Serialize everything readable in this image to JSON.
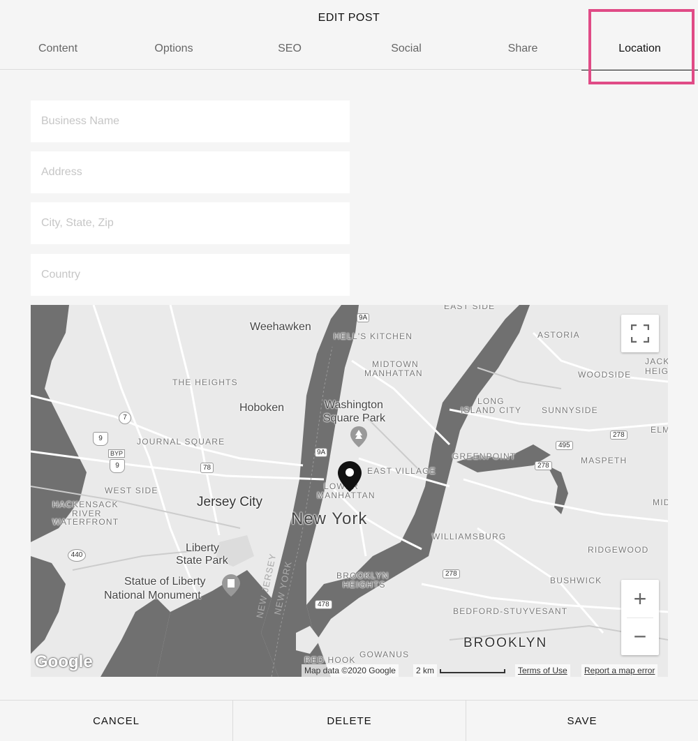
{
  "dialog": {
    "title": "EDIT POST"
  },
  "tabs": [
    {
      "label": "Content"
    },
    {
      "label": "Options"
    },
    {
      "label": "SEO"
    },
    {
      "label": "Social"
    },
    {
      "label": "Share"
    },
    {
      "label": "Location",
      "active": true
    }
  ],
  "highlight_color": "#e04b86",
  "form": {
    "business_name": {
      "value": "",
      "placeholder": "Business Name"
    },
    "address": {
      "value": "",
      "placeholder": "Address"
    },
    "city_state_zip": {
      "value": "",
      "placeholder": "City, State, Zip"
    },
    "country": {
      "value": "",
      "placeholder": "Country"
    }
  },
  "map": {
    "labels": {
      "east_side": "EAST SIDE",
      "weehawken": "Weehawken",
      "hells_kitchen": "HELL'S KITCHEN",
      "astoria": "ASTORIA",
      "jackson_heights": "JACK HEIG",
      "midtown": "MIDTOWN",
      "manhattan": "MANHATTAN",
      "the_heights": "THE HEIGHTS",
      "woodside": "WOODSIDE",
      "hoboken": "Hoboken",
      "washington_sq": "Washington",
      "square_park": "Square Park",
      "long_island_city_1": "LONG",
      "long_island_city_2": "ISLAND CITY",
      "sunnyside": "SUNNYSIDE",
      "journal_square": "JOURNAL SQUARE",
      "elm": "ELM",
      "greenpoint": "GREENPOINT",
      "maspeth": "MASPETH",
      "east_village": "EAST VILLAGE",
      "west_side": "WEST SIDE",
      "lower_manhattan_1": "LOWER",
      "lower_manhattan_2": "MANHATTAN",
      "jersey_city": "Jersey City",
      "hackensack_1": "HACKENSACK",
      "hackensack_2": "RIVER",
      "hackensack_3": "WATERFRONT",
      "new_york": "New York",
      "mid": "MID",
      "williamsburg": "WILLIAMSBURG",
      "liberty_sp_1": "Liberty",
      "liberty_sp_2": "State Park",
      "ridgewood": "RIDGEWOOD",
      "brooklyn_heights_1": "BROOKLYN",
      "brooklyn_heights_2": "HEIGHTS",
      "bushwick": "BUSHWICK",
      "statue_1": "Statue of Liberty",
      "statue_2": "National Monument",
      "new_jersey_water": "NEW JERSEY",
      "new_york_water": "NEW YORK",
      "bed_stuy": "BEDFORD-STUYVESANT",
      "brooklyn": "BROOKLYN",
      "red_hook": "RED HOOK",
      "gowanus": "GOWANUS"
    },
    "shields": {
      "r9a_top": "9A",
      "r7": "7",
      "r9": "9",
      "byp": "BYP",
      "r9b": "9",
      "r78": "78",
      "r9a_mid": "9A",
      "r495": "495",
      "r278_a": "278",
      "r278_b": "278",
      "r440": "440",
      "r278_c": "278",
      "r478": "478"
    },
    "zoom_in": "+",
    "zoom_out": "−",
    "google_logo": "Google",
    "attribution": "Map data ©2020 Google",
    "scale": "2 km",
    "terms": "Terms of Use",
    "report": "Report a map error",
    "water_color": "#707070",
    "land_color": "#eaeaea"
  },
  "footer": {
    "cancel": "CANCEL",
    "delete": "DELETE",
    "save": "SAVE"
  }
}
